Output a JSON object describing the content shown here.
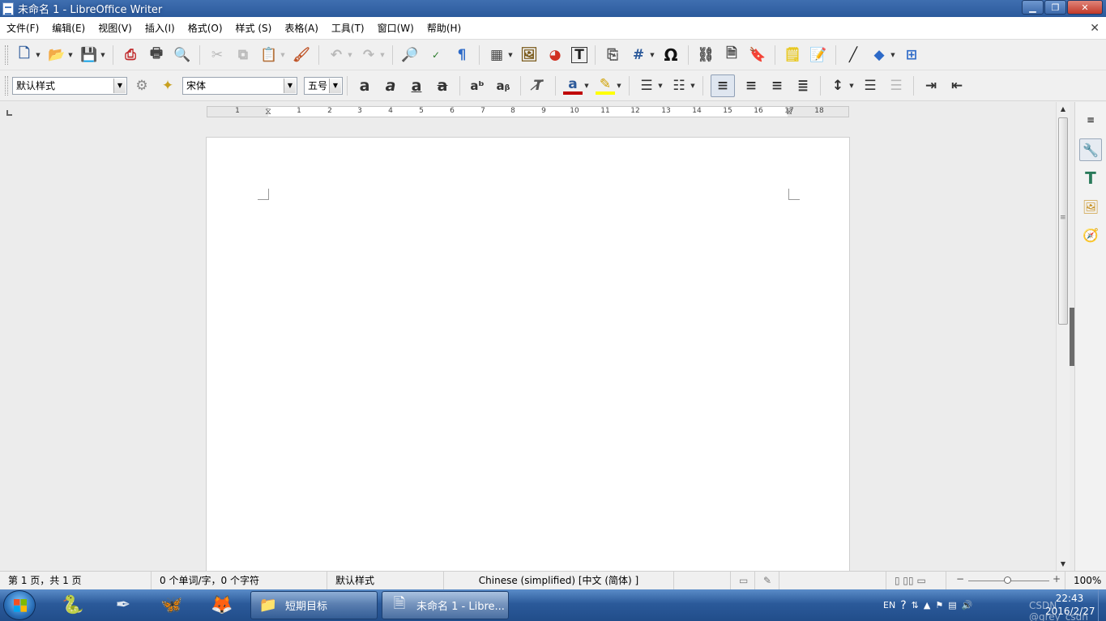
{
  "window": {
    "title": "未命名 1 - LibreOffice Writer",
    "min": "▁",
    "max": "❐",
    "close": "✕"
  },
  "menu": {
    "items": [
      "文件(F)",
      "编辑(E)",
      "视图(V)",
      "插入(I)",
      "格式(O)",
      "样式 (S)",
      "表格(A)",
      "工具(T)",
      "窗口(W)",
      "帮助(H)"
    ],
    "close": "✕"
  },
  "formatting": {
    "paragraph_style": "默认样式",
    "font_name": "宋体",
    "font_size": "五号"
  },
  "ruler": {
    "numbers": [
      "1",
      "1",
      "2",
      "3",
      "4",
      "5",
      "6",
      "7",
      "8",
      "9",
      "10",
      "11",
      "12",
      "13",
      "14",
      "15",
      "16",
      "17",
      "18"
    ]
  },
  "statusbar": {
    "page": "第 1 页，共 1 页",
    "words": "0 个单词/字，0 个字符",
    "style": "默认样式",
    "language": "Chinese (simplified) [中文 (简体) ]",
    "zoom": "100%"
  },
  "taskbar": {
    "tasks": [
      {
        "label": "短期目标",
        "icon": "folder-icon"
      },
      {
        "label": "未命名 1 - Libre...",
        "icon": "writer-icon"
      }
    ],
    "tray_lang": "EN",
    "time": "22:43",
    "date": "2016/2/27",
    "watermark": "CSDN @grey_csdn"
  },
  "colors": {
    "titlebar": "#2b5a9c",
    "taskbar": "#214d8a",
    "font_color": "#c00000",
    "highlight": "#ffff00"
  }
}
